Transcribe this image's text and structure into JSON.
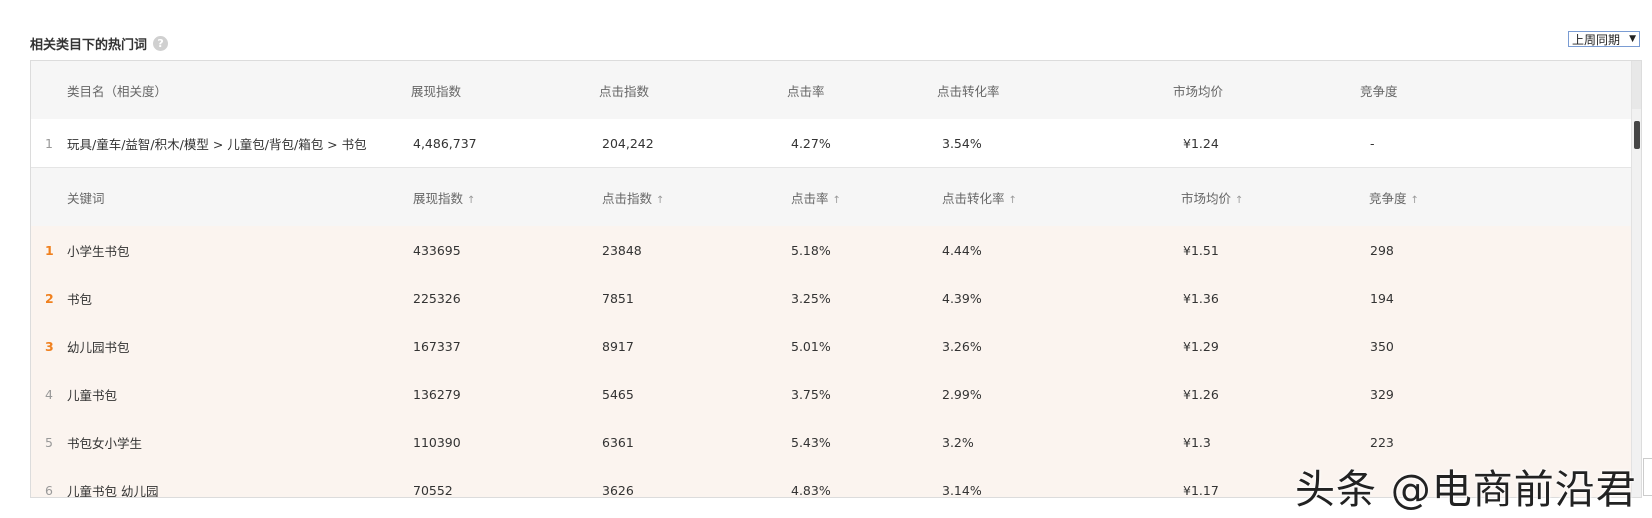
{
  "section": {
    "title": "相关类目下的热门词",
    "help_icon": "?",
    "period_label": "上周同期"
  },
  "category_header": {
    "col_name": "类目名（相关度）",
    "col_impressions": "展现指数",
    "col_clicks": "点击指数",
    "col_ctr": "点击率",
    "col_cvr": "点击转化率",
    "col_price": "市场均价",
    "col_competition": "竞争度"
  },
  "category_row": {
    "index": "1",
    "name": "玩具/童车/益智/积木/模型 > 儿童包/背包/箱包 > 书包",
    "impressions": "4,486,737",
    "clicks": "204,242",
    "ctr": "4.27%",
    "cvr": "3.54%",
    "price": "¥1.24",
    "competition": "-"
  },
  "keyword_header": {
    "col_keyword": "关键词",
    "col_impressions": "展现指数",
    "col_clicks": "点击指数",
    "col_ctr": "点击率",
    "col_cvr": "点击转化率",
    "col_price": "市场均价",
    "col_competition": "竞争度",
    "sort_icon": "↑"
  },
  "keywords": [
    {
      "index": "1",
      "keyword": "小学生书包",
      "impressions": "433695",
      "clicks": "23848",
      "ctr": "5.18%",
      "cvr": "4.44%",
      "price": "¥1.51",
      "competition": "298"
    },
    {
      "index": "2",
      "keyword": "书包",
      "impressions": "225326",
      "clicks": "7851",
      "ctr": "3.25%",
      "cvr": "4.39%",
      "price": "¥1.36",
      "competition": "194"
    },
    {
      "index": "3",
      "keyword": "幼儿园书包",
      "impressions": "167337",
      "clicks": "8917",
      "ctr": "5.01%",
      "cvr": "3.26%",
      "price": "¥1.29",
      "competition": "350"
    },
    {
      "index": "4",
      "keyword": "儿童书包",
      "impressions": "136279",
      "clicks": "5465",
      "ctr": "3.75%",
      "cvr": "2.99%",
      "price": "¥1.26",
      "competition": "329"
    },
    {
      "index": "5",
      "keyword": "书包女小学生",
      "impressions": "110390",
      "clicks": "6361",
      "ctr": "5.43%",
      "cvr": "3.2%",
      "price": "¥1.3",
      "competition": "223"
    },
    {
      "index": "6",
      "keyword": "儿童书包 幼儿园",
      "impressions": "70552",
      "clicks": "3626",
      "ctr": "4.83%",
      "cvr": "3.14%",
      "price": "¥1.17",
      "competition": ""
    }
  ],
  "watermark": "头条 @电商前沿君",
  "colors": {
    "header_bg": "#f6f6f6",
    "keyword_row_bg": "#fbf4ef",
    "top_rank": "#f0801e"
  }
}
